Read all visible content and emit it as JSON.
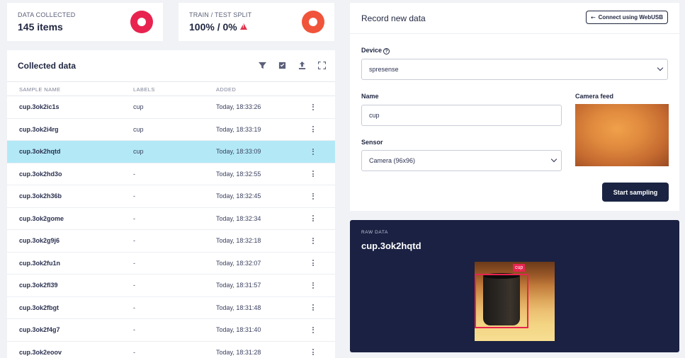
{
  "stats": {
    "collected_label": "DATA COLLECTED",
    "collected_value": "145 items",
    "split_label": "TRAIN / TEST SPLIT",
    "split_value": "100% / 0%",
    "split_warning_icon": "warning-icon",
    "accent_colors": {
      "collected_donut": "#e8234f",
      "split_donut": "#f0543a"
    }
  },
  "table": {
    "title": "Collected data",
    "tools": [
      "filter-icon",
      "select-icon",
      "upload-icon",
      "expand-icon"
    ],
    "columns": {
      "name": "SAMPLE NAME",
      "labels": "LABELS",
      "added": "ADDED"
    },
    "rows": [
      {
        "name": "cup.3ok2ic1s",
        "label": "cup",
        "added": "Today, 18:33:26"
      },
      {
        "name": "cup.3ok2i4rg",
        "label": "cup",
        "added": "Today, 18:33:19"
      },
      {
        "name": "cup.3ok2hqtd",
        "label": "cup",
        "added": "Today, 18:33:09",
        "selected": true
      },
      {
        "name": "cup.3ok2hd3o",
        "label": "-",
        "added": "Today, 18:32:55"
      },
      {
        "name": "cup.3ok2h36b",
        "label": "-",
        "added": "Today, 18:32:45"
      },
      {
        "name": "cup.3ok2gome",
        "label": "-",
        "added": "Today, 18:32:34"
      },
      {
        "name": "cup.3ok2g9j6",
        "label": "-",
        "added": "Today, 18:32:18"
      },
      {
        "name": "cup.3ok2fu1n",
        "label": "-",
        "added": "Today, 18:32:07"
      },
      {
        "name": "cup.3ok2fl39",
        "label": "-",
        "added": "Today, 18:31:57"
      },
      {
        "name": "cup.3ok2fbgt",
        "label": "-",
        "added": "Today, 18:31:48"
      },
      {
        "name": "cup.3ok2f4g7",
        "label": "-",
        "added": "Today, 18:31:40"
      },
      {
        "name": "cup.3ok2eoov",
        "label": "-",
        "added": "Today, 18:31:28"
      }
    ],
    "selected_row_color": "#b3e9f6"
  },
  "record": {
    "title": "Record new data",
    "webusb_button": "Connect using WebUSB",
    "device_label": "Device",
    "device_value": "spresense",
    "name_label": "Name",
    "name_value": "cup",
    "sensor_label": "Sensor",
    "sensor_value": "Camera (96x96)",
    "camera_label": "Camera feed",
    "start_button": "Start sampling"
  },
  "raw": {
    "label": "RAW DATA",
    "title": "cup.3ok2hqtd",
    "bbox_label": "cup",
    "panel_color": "#1a2142"
  }
}
